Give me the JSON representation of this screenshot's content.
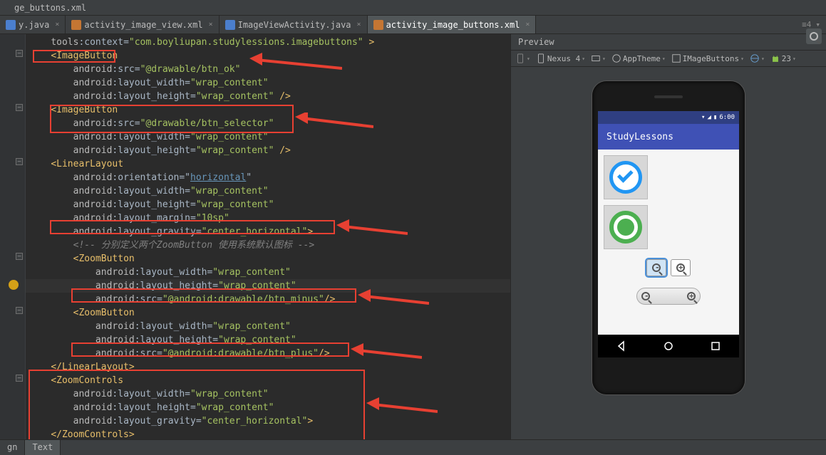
{
  "top_tab": "ge_buttons.xml",
  "tabs": [
    {
      "label": "y.java",
      "type": "java",
      "active": false
    },
    {
      "label": "activity_image_view.xml",
      "type": "xml",
      "active": false
    },
    {
      "label": "ImageViewActivity.java",
      "type": "java",
      "active": false
    },
    {
      "label": "activity_image_buttons.xml",
      "type": "xml",
      "active": true
    }
  ],
  "tab_extras": "≡4",
  "preview_title": "Preview",
  "toolbar": {
    "device": "Nexus 4",
    "theme": "AppTheme",
    "activity": "IMageButtons",
    "api": "23"
  },
  "bottom_tabs": {
    "design": "gn",
    "text": "Text"
  },
  "phone": {
    "time": "6:00",
    "app_title": "StudyLessons"
  },
  "code": {
    "l1_a": "tools",
    "l1_b": "context",
    "l1_c": "\"com.boyliupan.studylessions.imagebuttons\"",
    "l2_t": "ImageButton",
    "l3_ns": "android",
    "l3_a": "src",
    "l3_v": "\"@drawable/btn_ok\"",
    "l4_ns": "android",
    "l4_a": "layout_width",
    "l4_v": "\"wrap_content\"",
    "l5_ns": "android",
    "l5_a": "layout_height",
    "l5_v": "\"wrap_content\"",
    "l6_t": "ImageButton",
    "l7_ns": "android",
    "l7_a": "src",
    "l7_v": "\"@drawable/btn_selector\"",
    "l8_ns": "android",
    "l8_a": "layout_width",
    "l8_v": "\"wrap_content\"",
    "l9_ns": "android",
    "l9_a": "layout_height",
    "l9_v": "\"wrap_content\"",
    "l10_t": "LinearLayout",
    "l11_ns": "android",
    "l11_a": "orientation",
    "l11_v": "horizontal",
    "l12_ns": "android",
    "l12_a": "layout_width",
    "l12_v": "\"wrap_content\"",
    "l13_ns": "android",
    "l13_a": "layout_height",
    "l13_v": "\"wrap_content\"",
    "l14_ns": "android",
    "l14_a": "layout_margin",
    "l14_v": "\"10sp\"",
    "l15_ns": "android",
    "l15_a": "layout_gravity",
    "l15_v": "\"center_horizontal\"",
    "l16_c": "<!-- 分别定义两个ZoomButton 使用系统默认图标 -->",
    "l17_t": "ZoomButton",
    "l18_ns": "android",
    "l18_a": "layout_width",
    "l18_v": "\"wrap_content\"",
    "l19_ns": "android",
    "l19_a": "layout_height",
    "l19_v": "\"wrap_content\"",
    "l20_ns": "android",
    "l20_a": "src",
    "l20_v": "\"@android:drawable/btn_minus\"",
    "l21_t": "ZoomButton",
    "l22_ns": "android",
    "l22_a": "layout_width",
    "l22_v": "\"wrap_content\"",
    "l23_ns": "android",
    "l23_a": "layout_height",
    "l23_v": "\"wrap_content\"",
    "l24_ns": "android",
    "l24_a": "src",
    "l24_v": "\"@android:drawable/btn_plus\"",
    "l25_t": "LinearLayout",
    "l26_t": "ZoomControls",
    "l27_ns": "android",
    "l27_a": "layout_width",
    "l27_v": "\"wrap_content\"",
    "l28_ns": "android",
    "l28_a": "layout_height",
    "l28_v": "\"wrap_content\"",
    "l29_ns": "android",
    "l29_a": "layout_gravity",
    "l29_v": "\"center_horizontal\"",
    "l30_t": "ZoomControls"
  }
}
